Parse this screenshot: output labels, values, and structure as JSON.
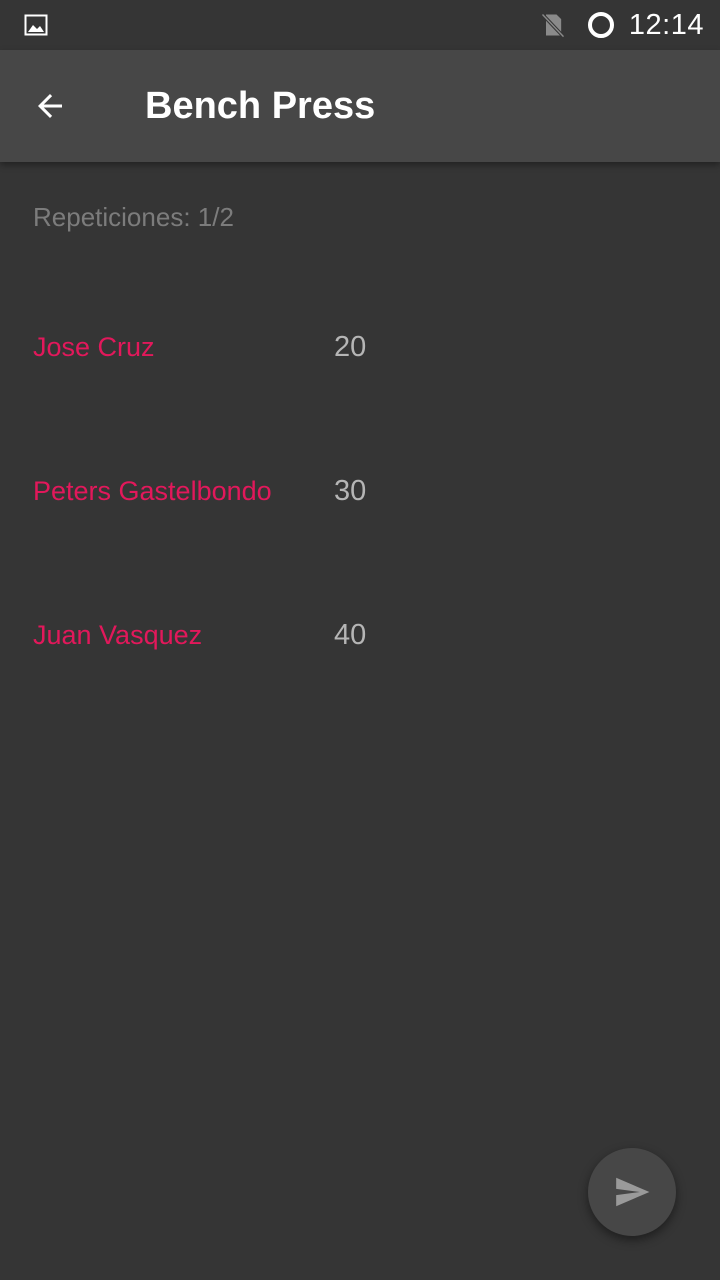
{
  "status_bar": {
    "time": "12:14",
    "icons": [
      "image-icon",
      "no-sim-icon",
      "loading-circle-icon"
    ]
  },
  "app_bar": {
    "title": "Bench Press",
    "back_icon": "arrow-back-icon"
  },
  "content": {
    "reps_label": "Repeticiones: 1/2",
    "rows": [
      {
        "name": "Jose Cruz",
        "value": "20"
      },
      {
        "name": "Peters Gastelbondo",
        "value": "30"
      },
      {
        "name": "Juan Vasquez",
        "value": "40"
      }
    ]
  },
  "fab": {
    "icon": "send-icon"
  },
  "colors": {
    "background": "#353535",
    "app_bar": "#474747",
    "accent": "#e2185b",
    "value_text": "#b5b5b5",
    "muted_text": "#7c7c7c"
  }
}
